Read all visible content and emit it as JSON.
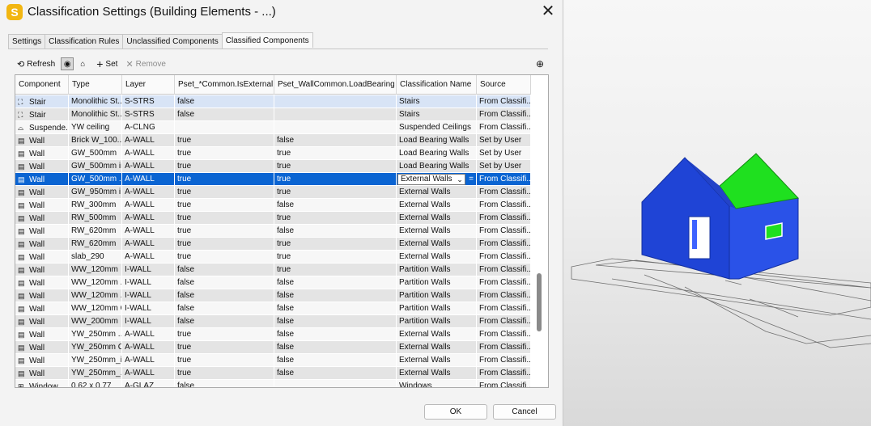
{
  "dialog": {
    "app_icon_letter": "S",
    "title": "Classification Settings (Building Elements - ...)"
  },
  "tabs": [
    {
      "label": "Settings",
      "active": false
    },
    {
      "label": "Classification Rules",
      "active": false
    },
    {
      "label": "Unclassified Components",
      "active": false
    },
    {
      "label": "Classified Components",
      "active": true
    }
  ],
  "toolbar": {
    "refresh_label": "Refresh",
    "set_label": "Set",
    "remove_label": "Remove"
  },
  "grid": {
    "columns": [
      "Component",
      "Type",
      "Layer",
      "Pset_*Common.IsExternal",
      "Pset_WallCommon.LoadBearing",
      "Classification Name",
      "Source"
    ],
    "rows": [
      {
        "icon": "stair",
        "component": "Stair",
        "type": "Monolithic St...",
        "layer": "S-STRS",
        "is_external": "false",
        "load_bearing": "",
        "classification": "Stairs",
        "source": "From Classifi...",
        "state": "hl"
      },
      {
        "icon": "stair",
        "component": "Stair",
        "type": "Monolithic St...",
        "layer": "S-STRS",
        "is_external": "false",
        "load_bearing": "",
        "classification": "Stairs",
        "source": "From Classifi...",
        "state": "odd"
      },
      {
        "icon": "ceiling",
        "component": "Suspende...",
        "type": "YW ceiling",
        "layer": "A-CLNG",
        "is_external": "",
        "load_bearing": "",
        "classification": "Suspended Ceilings",
        "source": "From Classifi...",
        "state": "even"
      },
      {
        "icon": "wall",
        "component": "Wall",
        "type": "Brick W_100...",
        "layer": "A-WALL",
        "is_external": "true",
        "load_bearing": "false",
        "classification": "Load Bearing Walls",
        "source": "Set by User",
        "state": "odd"
      },
      {
        "icon": "wall",
        "component": "Wall",
        "type": "GW_500mm",
        "layer": "A-WALL",
        "is_external": "true",
        "load_bearing": "true",
        "classification": "Load Bearing Walls",
        "source": "Set by User",
        "state": "even"
      },
      {
        "icon": "wall",
        "component": "Wall",
        "type": "GW_500mm in",
        "layer": "A-WALL",
        "is_external": "true",
        "load_bearing": "true",
        "classification": "Load Bearing Walls",
        "source": "Set by User",
        "state": "odd"
      },
      {
        "icon": "wall",
        "component": "Wall",
        "type": "GW_500mm ...",
        "layer": "A-WALL",
        "is_external": "true",
        "load_bearing": "true",
        "classification": "External Walls",
        "source": "From Classifi...",
        "state": "sel",
        "editing": true
      },
      {
        "icon": "wall",
        "component": "Wall",
        "type": "GW_950mm i...",
        "layer": "A-WALL",
        "is_external": "true",
        "load_bearing": "true",
        "classification": "External Walls",
        "source": "From Classifi...",
        "state": "odd"
      },
      {
        "icon": "wall",
        "component": "Wall",
        "type": "RW_300mm",
        "layer": "A-WALL",
        "is_external": "true",
        "load_bearing": "false",
        "classification": "External Walls",
        "source": "From Classifi...",
        "state": "even"
      },
      {
        "icon": "wall",
        "component": "Wall",
        "type": "RW_500mm",
        "layer": "A-WALL",
        "is_external": "true",
        "load_bearing": "true",
        "classification": "External Walls",
        "source": "From Classifi...",
        "state": "odd"
      },
      {
        "icon": "wall",
        "component": "Wall",
        "type": "RW_620mm",
        "layer": "A-WALL",
        "is_external": "true",
        "load_bearing": "false",
        "classification": "External Walls",
        "source": "From Classifi...",
        "state": "even"
      },
      {
        "icon": "wall",
        "component": "Wall",
        "type": "RW_620mm",
        "layer": "A-WALL",
        "is_external": "true",
        "load_bearing": "true",
        "classification": "External Walls",
        "source": "From Classifi...",
        "state": "odd"
      },
      {
        "icon": "wall",
        "component": "Wall",
        "type": "slab_290",
        "layer": "A-WALL",
        "is_external": "true",
        "load_bearing": "true",
        "classification": "External Walls",
        "source": "From Classifi...",
        "state": "even"
      },
      {
        "icon": "wall",
        "component": "Wall",
        "type": "WW_120mm",
        "layer": "I-WALL",
        "is_external": "false",
        "load_bearing": "true",
        "classification": "Partition Walls",
        "source": "From Classifi...",
        "state": "odd"
      },
      {
        "icon": "wall",
        "component": "Wall",
        "type": "WW_120mm ...",
        "layer": "I-WALL",
        "is_external": "false",
        "load_bearing": "false",
        "classification": "Partition Walls",
        "source": "From Classifi...",
        "state": "even"
      },
      {
        "icon": "wall",
        "component": "Wall",
        "type": "WW_120mm ...",
        "layer": "I-WALL",
        "is_external": "false",
        "load_bearing": "false",
        "classification": "Partition Walls",
        "source": "From Classifi...",
        "state": "odd"
      },
      {
        "icon": "wall",
        "component": "Wall",
        "type": "WW_120mm C",
        "layer": "I-WALL",
        "is_external": "false",
        "load_bearing": "false",
        "classification": "Partition Walls",
        "source": "From Classifi...",
        "state": "even"
      },
      {
        "icon": "wall",
        "component": "Wall",
        "type": "WW_200mm",
        "layer": "I-WALL",
        "is_external": "false",
        "load_bearing": "false",
        "classification": "Partition Walls",
        "source": "From Classifi...",
        "state": "odd"
      },
      {
        "icon": "wall",
        "component": "Wall",
        "type": "YW_250mm ...",
        "layer": "A-WALL",
        "is_external": "true",
        "load_bearing": "false",
        "classification": "External Walls",
        "source": "From Classifi...",
        "state": "even"
      },
      {
        "icon": "wall",
        "component": "Wall",
        "type": "YW_250mm C",
        "layer": "A-WALL",
        "is_external": "true",
        "load_bearing": "false",
        "classification": "External Walls",
        "source": "From Classifi...",
        "state": "odd"
      },
      {
        "icon": "wall",
        "component": "Wall",
        "type": "YW_250mm_in",
        "layer": "A-WALL",
        "is_external": "true",
        "load_bearing": "false",
        "classification": "External Walls",
        "source": "From Classifi...",
        "state": "even"
      },
      {
        "icon": "wall",
        "component": "Wall",
        "type": "YW_250mm_...",
        "layer": "A-WALL",
        "is_external": "true",
        "load_bearing": "false",
        "classification": "External Walls",
        "source": "From Classifi...",
        "state": "odd"
      },
      {
        "icon": "window",
        "component": "Window",
        "type": "0.62 x 0.77",
        "layer": "A-GLAZ",
        "is_external": "false",
        "load_bearing": "",
        "classification": "Windows",
        "source": "From Classifi...",
        "state": "even"
      }
    ],
    "edit_equals": "="
  },
  "footer": {
    "ok_label": "OK",
    "cancel_label": "Cancel"
  },
  "colors": {
    "selection": "#0a64d2",
    "house_walls": "#1f44d6",
    "house_roof_green": "#1fe01f",
    "app_icon": "#f2b611"
  }
}
